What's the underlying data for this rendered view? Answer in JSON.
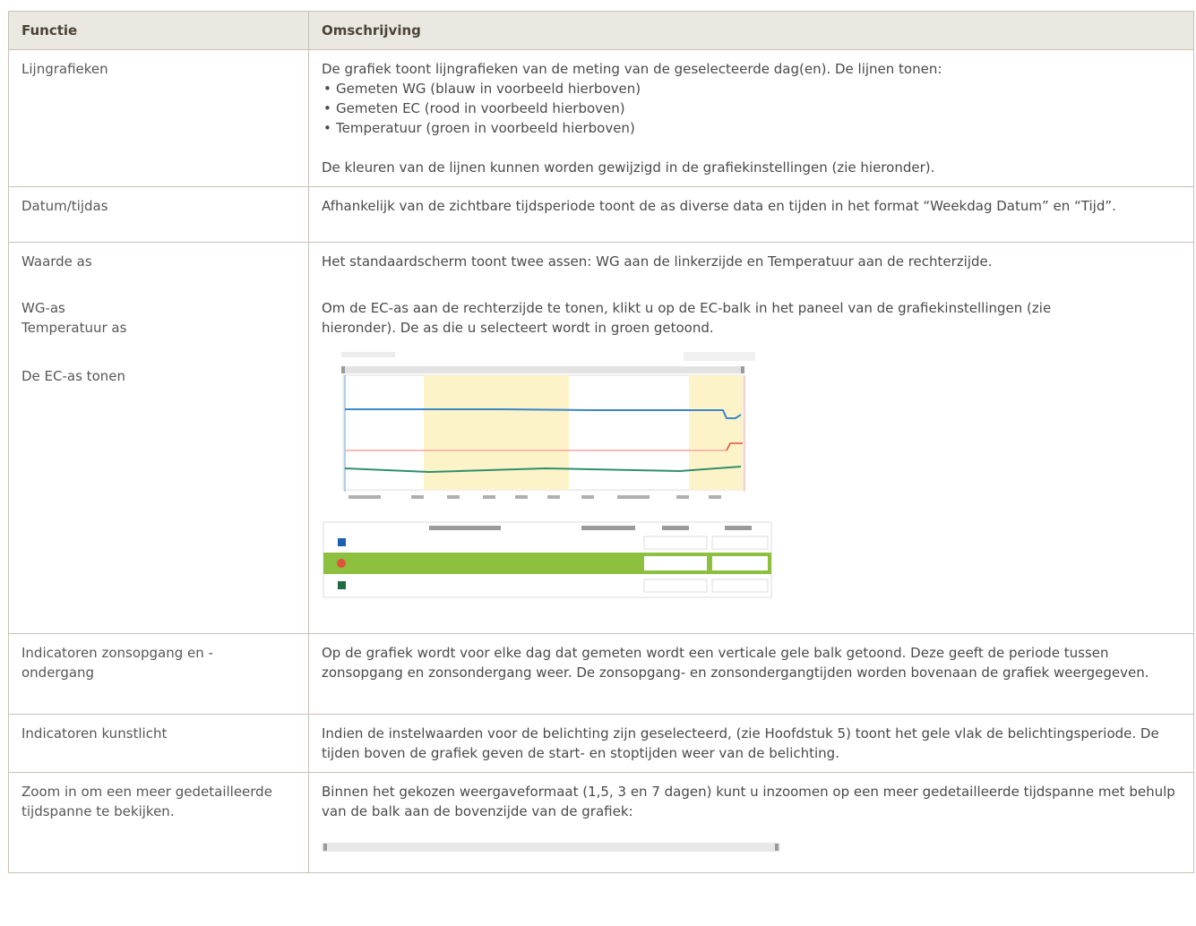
{
  "table": {
    "header": {
      "col1": "Functie",
      "col2": "Omschrijving"
    },
    "rows": [
      {
        "function": "Lijngrafieken",
        "intro": "De grafiek toont lijngrafieken van de meting van de geselecteerde dag(en). De lijnen tonen:",
        "bullets": [
          "Gemeten WG (blauw in voorbeeld hierboven)",
          "Gemeten EC (rood in voorbeeld hierboven)",
          "Temperatuur (groen in voorbeeld hierboven)"
        ],
        "outro": "De kleuren van de lijnen kunnen worden gewijzigd in de grafiekinstellingen (zie hieronder)."
      },
      {
        "function": "Datum/tijdas",
        "text": "Afhankelijk van de zichtbare tijdsperiode toont de as diverse data en tijden in het format “Weekdag Datum” en “Tijd”."
      },
      {
        "function_lines": [
          "Waarde as",
          "WG-as",
          "Temperatuur as",
          "De EC-as tonen"
        ],
        "text1": "Het standaardscherm toont twee assen: WG aan de linkerzijde en Temperatuur aan de rechterzijde.",
        "text2": "Om de EC-as aan de rechterzijde te tonen, klikt u op de EC-balk in het paneel van de grafiekinstellingen (zie hieronder). De as die u selecteert wordt in groen getoond."
      },
      {
        "function": "Indicatoren zonsopgang en -ondergang",
        "text": "Op de grafiek wordt voor elke dag dat gemeten wordt een verticale gele balk getoond. Deze geeft de periode tussen zonsopgang en zonsondergang weer. De zonsopgang- en zonsondergangtijden worden bovenaan de grafiek weergegeven."
      },
      {
        "function": "Indicatoren kunstlicht",
        "text": "Indien de instelwaarden voor de belichting zijn geselecteerd, (zie Hoofdstuk 5) toont het gele vlak de belichtingsperiode. De tijden boven de grafiek geven de start- en stoptijden weer van de belichting."
      },
      {
        "function": "Zoom in om een meer gedetailleerde tijdspanne te bekijken.",
        "text": "Binnen het gekozen weergaveformaat (1,5, 3 en 7 dagen) kunt u inzoomen op een meer gedetailleerde tijdspanne met behulp van de balk aan de bovenzijde van de grafiek:"
      }
    ]
  },
  "colors": {
    "wg_line": "#3b87c8",
    "ec_line": "#e0533b",
    "temp_line": "#2f8f6b",
    "daylight": "#fdf3c8",
    "selected_row": "#8dc03f",
    "header_bg": "#ebe8e2"
  },
  "icons": [
    "wg-color-swatch-icon",
    "ec-color-swatch-icon",
    "temp-color-swatch-icon",
    "zoom-handle-icon"
  ]
}
